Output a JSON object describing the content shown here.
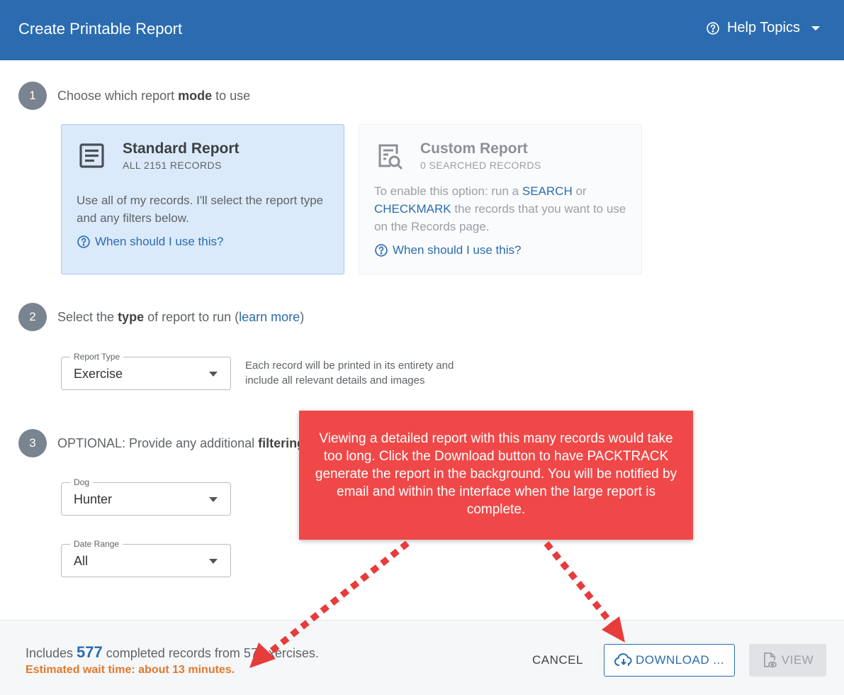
{
  "header": {
    "title": "Create Printable Report",
    "help_label": "Help Topics"
  },
  "step1": {
    "number": "1",
    "text_before": "Choose which report ",
    "text_bold": "mode",
    "text_after": " to use"
  },
  "standard_card": {
    "title": "Standard Report",
    "subtitle": "ALL 2151 RECORDS",
    "description": "Use all of my records. I'll select the report type and any filters below.",
    "when_link": "When should I use this?"
  },
  "custom_card": {
    "title": "Custom Report",
    "subtitle": "0 SEARCHED RECORDS",
    "desc_part1": "To enable this option: run a ",
    "desc_search": "SEARCH",
    "desc_part2": " or ",
    "desc_checkmark": "CHECKMARK",
    "desc_part3": " the records that you want to use on the Records page.",
    "when_link": "When should I use this?"
  },
  "step2": {
    "number": "2",
    "text_before": "Select the ",
    "text_bold": "type",
    "text_after": " of report to run (",
    "link": "learn more",
    "text_end": ")"
  },
  "report_type": {
    "label": "Report Type",
    "value": "Exercise",
    "description": "Each record will be printed in its entirety and include all relevant details and images"
  },
  "step3": {
    "number": "3",
    "text_before": "OPTIONAL: Provide any additional ",
    "text_bold": "filtering"
  },
  "dog_filter": {
    "label": "Dog",
    "value": "Hunter"
  },
  "date_filter": {
    "label": "Date Range",
    "value": "All"
  },
  "callout": {
    "text": "Viewing a detailed report with this many records would take too long. Click the Download button to have PACKTRACK generate the report in the background. You will be notified by email and within the interface when the large report is complete.",
    "color": "#f04848"
  },
  "footer": {
    "includes_before": "Includes ",
    "count": "577",
    "includes_middle": " completed records from 5",
    "includes_after": "7 exercises.",
    "estimate": "Estimated wait time: about 13 minutes.",
    "cancel_label": "CANCEL",
    "download_label": "DOWNLOAD ...",
    "view_label": "VIEW"
  },
  "colors": {
    "header_bg": "#2b6cb0",
    "accent": "#2b6cb0",
    "warning": "#e07a2c"
  }
}
